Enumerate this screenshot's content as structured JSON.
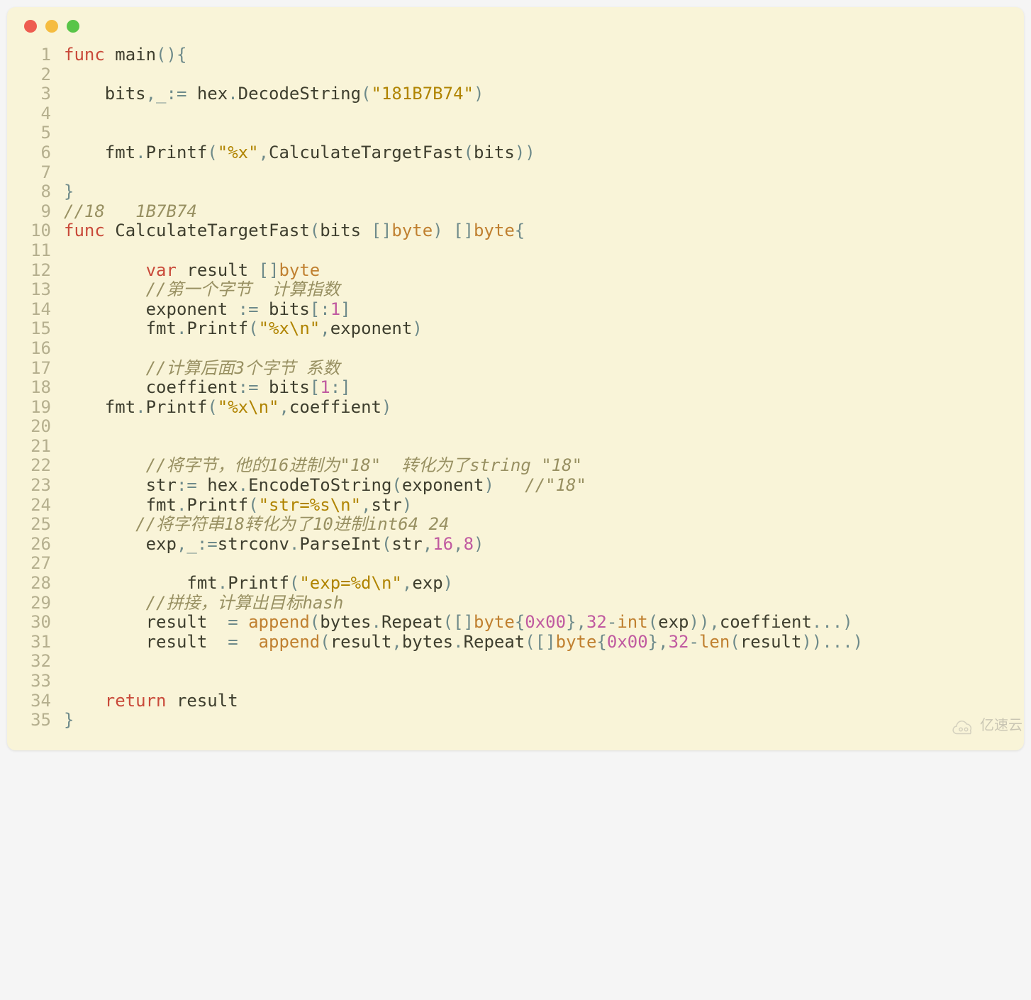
{
  "window": {
    "dots": [
      "red",
      "yellow",
      "green"
    ]
  },
  "watermark": {
    "text": "亿速云"
  },
  "lines": [
    {
      "n": "1",
      "tokens": [
        [
          "kw",
          "func"
        ],
        [
          "id",
          " main"
        ],
        [
          "sl",
          "("
        ],
        [
          "sl",
          ")"
        ],
        [
          "sl",
          "{"
        ]
      ]
    },
    {
      "n": "2",
      "tokens": []
    },
    {
      "n": "3",
      "tokens": [
        [
          "",
          "    "
        ],
        [
          "id",
          "bits"
        ],
        [
          "sl",
          ",_:="
        ],
        [
          "id",
          " hex"
        ],
        [
          "sl",
          "."
        ],
        [
          "id",
          "DecodeString"
        ],
        [
          "sl",
          "("
        ],
        [
          "str",
          "\"181B7B74\""
        ],
        [
          "sl",
          ")"
        ]
      ]
    },
    {
      "n": "4",
      "tokens": []
    },
    {
      "n": "5",
      "tokens": []
    },
    {
      "n": "6",
      "tokens": [
        [
          "",
          "    "
        ],
        [
          "id",
          "fmt"
        ],
        [
          "sl",
          "."
        ],
        [
          "id",
          "Printf"
        ],
        [
          "sl",
          "("
        ],
        [
          "str",
          "\"%x\""
        ],
        [
          "sl",
          ","
        ],
        [
          "id",
          "CalculateTargetFast"
        ],
        [
          "sl",
          "("
        ],
        [
          "id",
          "bits"
        ],
        [
          "sl",
          "))"
        ]
      ]
    },
    {
      "n": "7",
      "tokens": []
    },
    {
      "n": "8",
      "tokens": [
        [
          "sl",
          "}"
        ]
      ]
    },
    {
      "n": "9",
      "tokens": [
        [
          "cm",
          "//18   1B7B74"
        ]
      ]
    },
    {
      "n": "10",
      "tokens": [
        [
          "kw",
          "func"
        ],
        [
          "id",
          " CalculateTargetFast"
        ],
        [
          "sl",
          "("
        ],
        [
          "id",
          "bits "
        ],
        [
          "sl",
          "[]"
        ],
        [
          "ty",
          "byte"
        ],
        [
          "sl",
          ") []"
        ],
        [
          "ty",
          "byte"
        ],
        [
          "sl",
          "{"
        ]
      ]
    },
    {
      "n": "11",
      "tokens": []
    },
    {
      "n": "12",
      "tokens": [
        [
          "",
          "        "
        ],
        [
          "kw",
          "var"
        ],
        [
          "id",
          " result "
        ],
        [
          "sl",
          "[]"
        ],
        [
          "ty",
          "byte"
        ]
      ]
    },
    {
      "n": "13",
      "tokens": [
        [
          "",
          "        "
        ],
        [
          "cm",
          "//第一个字节  计算指数"
        ]
      ]
    },
    {
      "n": "14",
      "tokens": [
        [
          "",
          "        "
        ],
        [
          "id",
          "exponent "
        ],
        [
          "sl",
          ":="
        ],
        [
          "id",
          " bits"
        ],
        [
          "sl",
          "[:"
        ],
        [
          "num",
          "1"
        ],
        [
          "sl",
          "]"
        ]
      ]
    },
    {
      "n": "15",
      "tokens": [
        [
          "",
          "        "
        ],
        [
          "id",
          "fmt"
        ],
        [
          "sl",
          "."
        ],
        [
          "id",
          "Printf"
        ],
        [
          "sl",
          "("
        ],
        [
          "str",
          "\"%x\\n\""
        ],
        [
          "sl",
          ","
        ],
        [
          "id",
          "exponent"
        ],
        [
          "sl",
          ")"
        ]
      ]
    },
    {
      "n": "16",
      "tokens": []
    },
    {
      "n": "17",
      "tokens": [
        [
          "",
          "        "
        ],
        [
          "cm",
          "//计算后面3个字节 系数"
        ]
      ]
    },
    {
      "n": "18",
      "tokens": [
        [
          "",
          "        "
        ],
        [
          "id",
          "coeffient"
        ],
        [
          "sl",
          ":="
        ],
        [
          "id",
          " bits"
        ],
        [
          "sl",
          "["
        ],
        [
          "num",
          "1"
        ],
        [
          "sl",
          ":]"
        ]
      ]
    },
    {
      "n": "19",
      "tokens": [
        [
          "",
          "    "
        ],
        [
          "id",
          "fmt"
        ],
        [
          "sl",
          "."
        ],
        [
          "id",
          "Printf"
        ],
        [
          "sl",
          "("
        ],
        [
          "str",
          "\"%x\\n\""
        ],
        [
          "sl",
          ","
        ],
        [
          "id",
          "coeffient"
        ],
        [
          "sl",
          ")"
        ]
      ]
    },
    {
      "n": "20",
      "tokens": []
    },
    {
      "n": "21",
      "tokens": []
    },
    {
      "n": "22",
      "tokens": [
        [
          "",
          "        "
        ],
        [
          "cm",
          "//将字节，他的16进制为\"18\"  转化为了string \"18\""
        ]
      ]
    },
    {
      "n": "23",
      "tokens": [
        [
          "",
          "        "
        ],
        [
          "id",
          "str"
        ],
        [
          "sl",
          ":="
        ],
        [
          "id",
          " hex"
        ],
        [
          "sl",
          "."
        ],
        [
          "id",
          "EncodeToString"
        ],
        [
          "sl",
          "("
        ],
        [
          "id",
          "exponent"
        ],
        [
          "sl",
          ")   "
        ],
        [
          "cm",
          "//\"18\""
        ]
      ]
    },
    {
      "n": "24",
      "tokens": [
        [
          "",
          "        "
        ],
        [
          "id",
          "fmt"
        ],
        [
          "sl",
          "."
        ],
        [
          "id",
          "Printf"
        ],
        [
          "sl",
          "("
        ],
        [
          "str",
          "\"str=%s\\n\""
        ],
        [
          "sl",
          ","
        ],
        [
          "id",
          "str"
        ],
        [
          "sl",
          ")"
        ]
      ]
    },
    {
      "n": "25",
      "tokens": [
        [
          "",
          "       "
        ],
        [
          "cm",
          "//将字符串18转化为了10进制int64 24"
        ]
      ]
    },
    {
      "n": "26",
      "tokens": [
        [
          "",
          "        "
        ],
        [
          "id",
          "exp"
        ],
        [
          "sl",
          ",_:="
        ],
        [
          "id",
          "strconv"
        ],
        [
          "sl",
          "."
        ],
        [
          "id",
          "ParseInt"
        ],
        [
          "sl",
          "("
        ],
        [
          "id",
          "str"
        ],
        [
          "sl",
          ","
        ],
        [
          "num",
          "16"
        ],
        [
          "sl",
          ","
        ],
        [
          "num",
          "8"
        ],
        [
          "sl",
          ")"
        ]
      ]
    },
    {
      "n": "27",
      "tokens": []
    },
    {
      "n": "28",
      "tokens": [
        [
          "",
          "            "
        ],
        [
          "id",
          "fmt"
        ],
        [
          "sl",
          "."
        ],
        [
          "id",
          "Printf"
        ],
        [
          "sl",
          "("
        ],
        [
          "str",
          "\"exp=%d\\n\""
        ],
        [
          "sl",
          ","
        ],
        [
          "id",
          "exp"
        ],
        [
          "sl",
          ")"
        ]
      ]
    },
    {
      "n": "29",
      "tokens": [
        [
          "",
          "        "
        ],
        [
          "cm",
          "//拼接，计算出目标hash"
        ]
      ]
    },
    {
      "n": "30",
      "tokens": [
        [
          "",
          "        "
        ],
        [
          "id",
          "result  "
        ],
        [
          "sl",
          "="
        ],
        [
          "id",
          " "
        ],
        [
          "ty",
          "append"
        ],
        [
          "sl",
          "("
        ],
        [
          "id",
          "bytes"
        ],
        [
          "sl",
          "."
        ],
        [
          "id",
          "Repeat"
        ],
        [
          "sl",
          "([]"
        ],
        [
          "ty",
          "byte"
        ],
        [
          "sl",
          "{"
        ],
        [
          "num",
          "0x00"
        ],
        [
          "sl",
          "},"
        ],
        [
          "num",
          "32"
        ],
        [
          "sl",
          "-"
        ],
        [
          "ty",
          "int"
        ],
        [
          "sl",
          "("
        ],
        [
          "id",
          "exp"
        ],
        [
          "sl",
          ")),"
        ],
        [
          "id",
          "coeffient"
        ],
        [
          "sl",
          "...)"
        ]
      ]
    },
    {
      "n": "31",
      "tokens": [
        [
          "",
          "        "
        ],
        [
          "id",
          "result  "
        ],
        [
          "sl",
          "=  "
        ],
        [
          "ty",
          "append"
        ],
        [
          "sl",
          "("
        ],
        [
          "id",
          "result"
        ],
        [
          "sl",
          ","
        ],
        [
          "id",
          "bytes"
        ],
        [
          "sl",
          "."
        ],
        [
          "id",
          "Repeat"
        ],
        [
          "sl",
          "([]"
        ],
        [
          "ty",
          "byte"
        ],
        [
          "sl",
          "{"
        ],
        [
          "num",
          "0x00"
        ],
        [
          "sl",
          "},"
        ],
        [
          "num",
          "32"
        ],
        [
          "sl",
          "-"
        ],
        [
          "ty",
          "len"
        ],
        [
          "sl",
          "("
        ],
        [
          "id",
          "result"
        ],
        [
          "sl",
          "))...)"
        ]
      ]
    },
    {
      "n": "32",
      "tokens": []
    },
    {
      "n": "33",
      "tokens": []
    },
    {
      "n": "34",
      "tokens": [
        [
          "",
          "    "
        ],
        [
          "kw",
          "return"
        ],
        [
          "id",
          " result"
        ]
      ]
    },
    {
      "n": "35",
      "tokens": [
        [
          "sl",
          "}"
        ]
      ]
    }
  ]
}
